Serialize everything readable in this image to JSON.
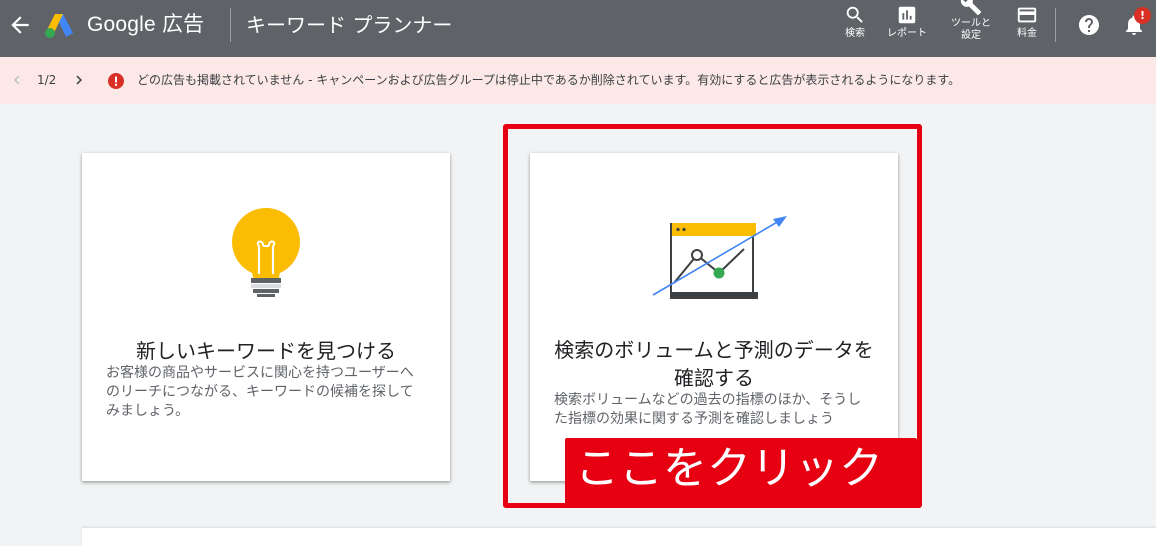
{
  "header": {
    "brand": "Google 広告",
    "tool_title": "キーワード プランナー",
    "nav": [
      {
        "label": "検索",
        "icon": "search-icon"
      },
      {
        "label": "レポート",
        "icon": "reports-icon"
      },
      {
        "label": "ツールと\n設定",
        "icon": "wrench-icon"
      },
      {
        "label": "料金",
        "icon": "credit-card-icon"
      }
    ],
    "notification_badge": "!"
  },
  "notification": {
    "page": "1/2",
    "message": "どの広告も掲載されていません - キャンペーンおよび広告グループは停止中であるか削除されています。有効にすると広告が表示されるようになります。"
  },
  "cards": [
    {
      "title": "新しいキーワードを見つける",
      "description": "お客様の商品やサービスに関心を持つユーザーへのリーチにつながる、キーワードの候補を探してみましょう。",
      "icon": "lightbulb-icon"
    },
    {
      "title": "検索のボリュームと予測のデータを確認する",
      "description": "検索ボリュームなどの過去の指標のほか、そうした指標の効果に関する予測を確認しましょう",
      "icon": "forecast-chart-icon"
    }
  ],
  "annotation": {
    "callout": "ここをクリック"
  },
  "colors": {
    "topbar": "#5f6368",
    "notification_bg": "#fce8e6",
    "annotation_red": "#e60012",
    "bulb_yellow": "#fbbc04",
    "arrow_blue": "#4285f4",
    "point_green": "#34a853"
  }
}
